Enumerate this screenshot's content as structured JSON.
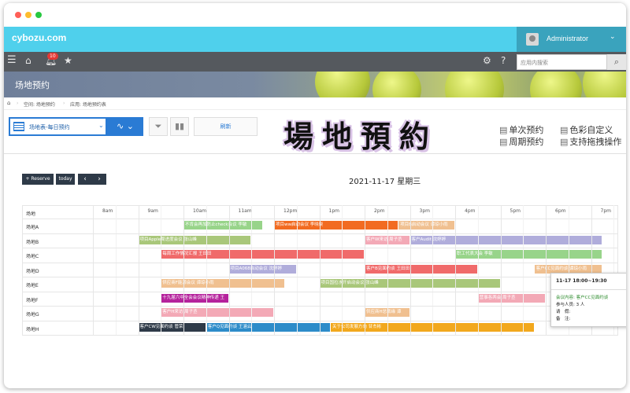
{
  "header": {
    "logo": "cybozu.com",
    "user": "Administrator"
  },
  "toolbar": {
    "notification_count": "10",
    "search_placeholder": "应用内搜索"
  },
  "banner": {
    "app_title": "场地预约"
  },
  "breadcrumb": {
    "space": "空间: 场地预约",
    "app": "应用: 场地预约表"
  },
  "controls": {
    "view_label": "场地表-每日预约",
    "refresh": "刷新"
  },
  "big_title": "場地預約",
  "features": [
    "单次预约",
    "周期预约",
    "色彩自定义",
    "支持拖拽操作"
  ],
  "calendar": {
    "reserve_btn": "+ Reserve",
    "today_btn": "today",
    "prev_btn": "‹",
    "next_btn": "›",
    "date": "2021-11-17 星期三",
    "corner": "场地",
    "hours": [
      "8am",
      "9am",
      "10am",
      "11am",
      "12pm",
      "1pm",
      "2pm",
      "3pm",
      "4pm",
      "5pm",
      "6pm",
      "7pm"
    ],
    "rooms": [
      "场地A",
      "场地B",
      "场地C",
      "场地D",
      "场地E",
      "场地F",
      "场地G",
      "场地H"
    ],
    "events": [
      {
        "row": 0,
        "start": 10.0,
        "end": 11.75,
        "color": "#98d48a",
        "text": "不肯会再加防止check会议 李敏"
      },
      {
        "row": 0,
        "start": 12.0,
        "end": 14.75,
        "color": "#f26b21",
        "text": "项目ww启动会议 李晓晓"
      },
      {
        "row": 0,
        "start": 14.75,
        "end": 16.0,
        "color": "#f0c090",
        "text": "项目B启动会议 谭琼小雨"
      },
      {
        "row": 1,
        "start": 9.0,
        "end": 11.5,
        "color": "#a9c77a",
        "text": "项目Apple周进度会议 张山峰"
      },
      {
        "row": 1,
        "start": 14.0,
        "end": 15.0,
        "color": "#f3a9b6",
        "text": "客户W来访 周子丞"
      },
      {
        "row": 1,
        "start": 15.0,
        "end": 19.25,
        "color": "#b0addb",
        "text": "客户Audit 沈婷婷"
      },
      {
        "row": 2,
        "start": 9.5,
        "end": 14.0,
        "color": "#f06a6a",
        "text": "每周工作情况汇报 王田田"
      },
      {
        "row": 2,
        "start": 16.0,
        "end": 19.25,
        "color": "#98d48a",
        "text": "职工代表大会 李敏"
      },
      {
        "row": 3,
        "start": 11.0,
        "end": 12.5,
        "color": "#b0addb",
        "text": "项目A068启动会议 沈婷婷"
      },
      {
        "row": 3,
        "start": 14.0,
        "end": 16.5,
        "color": "#f06a6a",
        "text": "客户B见面约谈 王田田"
      },
      {
        "row": 3,
        "start": 17.75,
        "end": 19.25,
        "color": "#f0c090",
        "text": "客户CC见面约谈 谭琼小雨"
      },
      {
        "row": 4,
        "start": 9.5,
        "end": 12.25,
        "color": "#f0c090",
        "text": "供应商F能源会议 谭琼小雨"
      },
      {
        "row": 4,
        "start": 13.0,
        "end": 17.0,
        "color": "#a9c77a",
        "text": "项目国拉水开启动会议 张山峰"
      },
      {
        "row": 5,
        "start": 9.5,
        "end": 11.0,
        "color": "#b5229c",
        "text": "十九届六中全会会议精神传递 王"
      },
      {
        "row": 5,
        "start": 16.5,
        "end": 18.0,
        "color": "#f3a9b6",
        "text": "营事各两会 周子丞"
      },
      {
        "row": 6,
        "start": 9.5,
        "end": 12.0,
        "color": "#f3a9b6",
        "text": "客户H来访 周子丞"
      },
      {
        "row": 6,
        "start": 14.0,
        "end": 15.0,
        "color": "#f0c090",
        "text": "供应商H总裁缘 谭"
      },
      {
        "row": 7,
        "start": 9.0,
        "end": 10.5,
        "color": "#2e3a48",
        "text": "客户CW见面约谈 管荣"
      },
      {
        "row": 7,
        "start": 10.5,
        "end": 13.25,
        "color": "#2d8cc9",
        "text": "客户Q见面约谈 王涵云"
      },
      {
        "row": 7,
        "start": 13.25,
        "end": 17.75,
        "color": "#f2a81d",
        "text": "关于公司发展方向 甘杰彬"
      }
    ]
  },
  "popup": {
    "time": "11-17 18:00~19:30",
    "meeting": "会议内容: 客户CC见面约谈",
    "attendees": "参与人员: 3 人",
    "leave": "请　假:",
    "note": "备　注:"
  },
  "colors": {
    "header": "#4fd0ec",
    "user_area": "#3aa3bd",
    "toolbar": "#55595e",
    "accent": "#2a7bd4"
  }
}
